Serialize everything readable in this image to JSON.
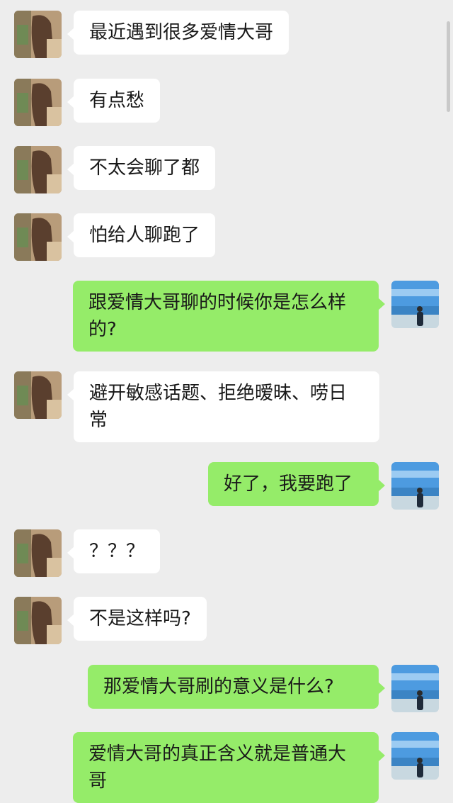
{
  "colors": {
    "background": "#ededed",
    "incoming_bubble": "#ffffff",
    "outgoing_bubble": "#95ec69",
    "text": "#191919"
  },
  "messages": [
    {
      "side": "left",
      "text": "最近遇到很多爱情大哥"
    },
    {
      "side": "left",
      "text": "有点愁"
    },
    {
      "side": "left",
      "text": "不太会聊了都"
    },
    {
      "side": "left",
      "text": "怕给人聊跑了"
    },
    {
      "side": "right",
      "text": "跟爱情大哥聊的时候你是怎么样的?"
    },
    {
      "side": "left",
      "text": "避开敏感话题、拒绝暧昧、唠日常"
    },
    {
      "side": "right",
      "text": "好了，我要跑了"
    },
    {
      "side": "left",
      "text": "？？？"
    },
    {
      "side": "left",
      "text": "不是这样吗?"
    },
    {
      "side": "right",
      "text": "那爱情大哥刷的意义是什么?"
    },
    {
      "side": "right",
      "text": "爱情大哥的真正含义就是普通大哥"
    }
  ]
}
